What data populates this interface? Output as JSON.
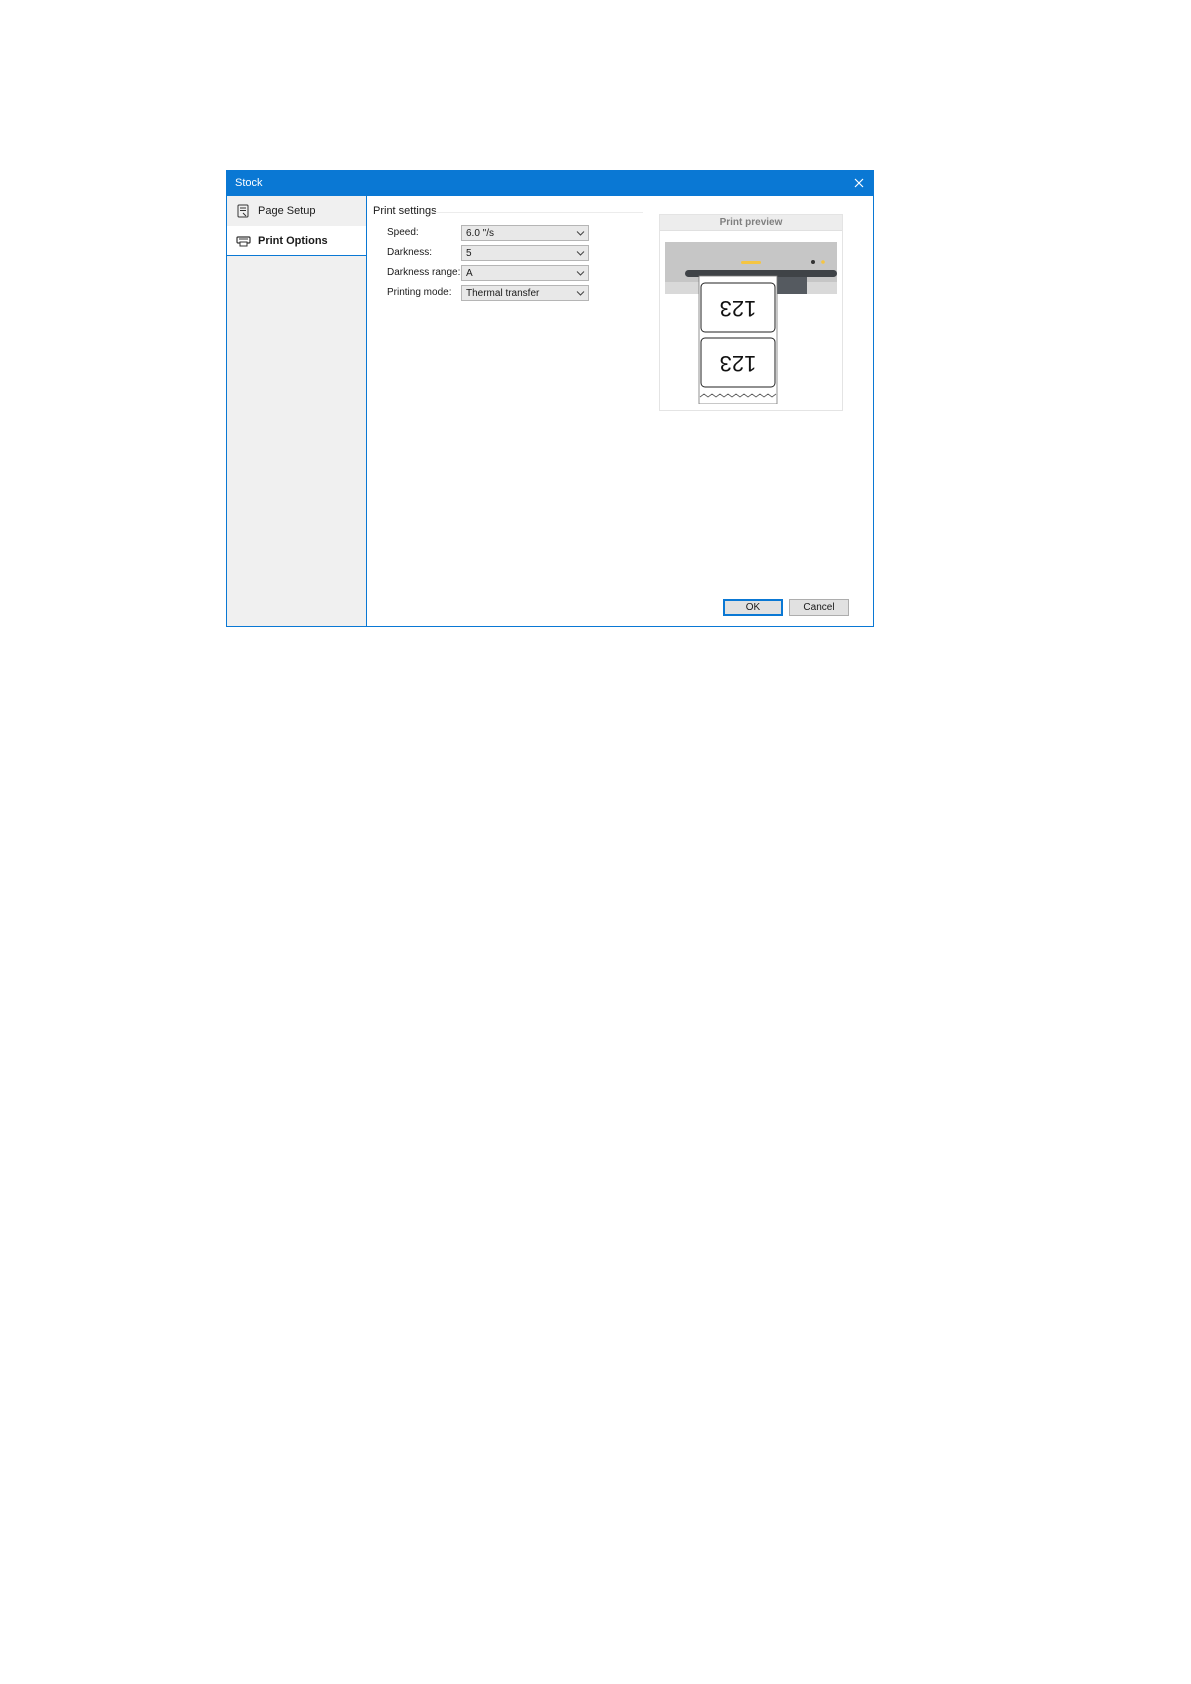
{
  "dialog": {
    "title": "Stock"
  },
  "sidebar": {
    "items": [
      {
        "label": "Page Setup",
        "icon": "page-setup-icon"
      },
      {
        "label": "Print Options",
        "icon": "printer-icon",
        "selected": true
      }
    ]
  },
  "print_settings": {
    "section_title": "Print settings",
    "fields": [
      {
        "label": "Speed:",
        "value": "6.0 \"/s"
      },
      {
        "label": "Darkness:",
        "value": "5"
      },
      {
        "label": "Darkness range:",
        "value": "A"
      },
      {
        "label": "Printing mode:",
        "value": "Thermal transfer"
      }
    ]
  },
  "preview": {
    "title": "Print preview",
    "label_text": "123"
  },
  "buttons": {
    "ok": "OK",
    "cancel": "Cancel"
  },
  "colors": {
    "accent": "#0a78d4",
    "sidebar_bg": "#f0f0f0",
    "led": "#f5c542"
  }
}
